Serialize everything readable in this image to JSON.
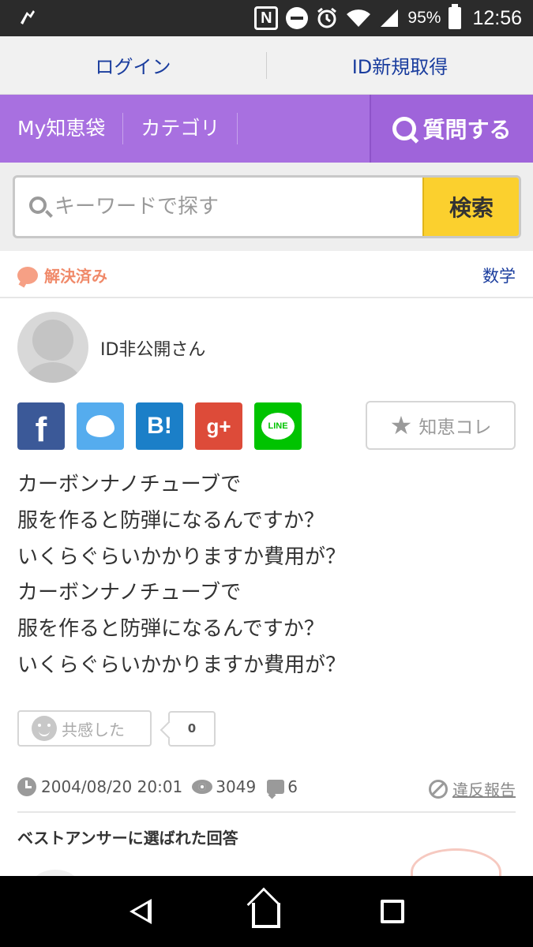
{
  "status_bar": {
    "battery": "95%",
    "time": "12:56"
  },
  "header": {
    "login": "ログイン",
    "register": "ID新規取得"
  },
  "nav": {
    "my": "My知恵袋",
    "category": "カテゴリ",
    "ask": "質問する"
  },
  "search": {
    "placeholder": "キーワードで探す",
    "button": "検索"
  },
  "question_status": {
    "badge": "解決済み",
    "category": "数学"
  },
  "user": {
    "name": "ID非公開さん"
  },
  "share": {
    "facebook": "f",
    "hatena": "B!",
    "google_plus": "g+",
    "line": "LINE",
    "chie_collection": "知恵コレ"
  },
  "question": {
    "text": "カーボンナノチューブで\n服を作ると防弾になるんですか？\nいくらぐらいかかりますか費用が？\nカーボンナノチューブで\n服を作ると防弾になるんですか？\nいくらぐらいかかりますか費用が？"
  },
  "empathy": {
    "label": "共感した",
    "count": "0"
  },
  "meta": {
    "datetime": "2004/08/20 20:01",
    "views": "3049",
    "answers": "6",
    "report": "違反報告"
  },
  "best_answer": {
    "heading": "ベストアンサーに選ばれた回答"
  },
  "colors": {
    "nav_purple": "#a870e0",
    "search_yellow": "#fbd02e",
    "link_blue": "#1a3d9e",
    "solved_orange": "#f08a6a"
  }
}
